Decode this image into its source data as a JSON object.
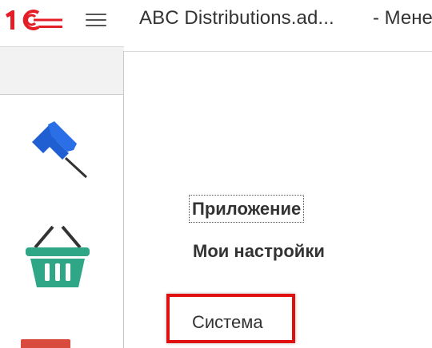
{
  "header": {
    "logo_icon": "1c-logo-icon",
    "menu_icon": "hamburger-menu-icon",
    "title": "ABC Distributions.ad...",
    "subtitle": "- Мене"
  },
  "sidebar": {
    "icons": [
      "pushpin-icon",
      "shopping-basket-icon",
      "partial-red-icon"
    ]
  },
  "menu": {
    "items": [
      {
        "label": "Приложение",
        "focused": true
      },
      {
        "label": "Мои настройки"
      },
      {
        "label": "Система",
        "highlighted": true
      }
    ]
  },
  "colors": {
    "logo_red": "#e41e26",
    "pin_blue": "#1f5fd1",
    "basket_green": "#2fa787",
    "highlight_red": "#e01010"
  }
}
